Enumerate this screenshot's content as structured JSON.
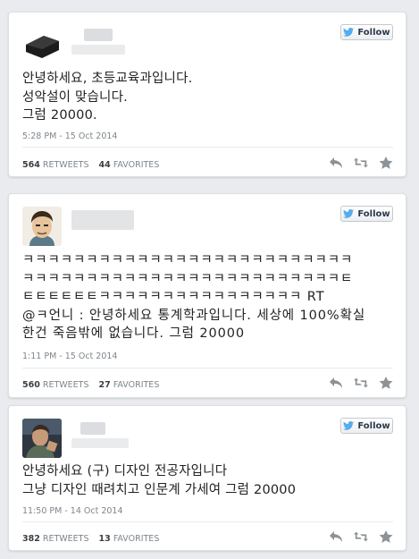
{
  "follow_label": "Follow",
  "tweets": [
    {
      "avatar_icon": "black-box-avatar",
      "text": "안녕하세요, 초등교육과입니다.\n성악설이 맞습니다.\n그럼 20000.",
      "timestamp": "5:28 PM - 15 Oct 2014",
      "retweets": "564",
      "retweets_label": "RETWEETS",
      "favorites": "44",
      "favorites_label": "FAVORITES"
    },
    {
      "avatar_icon": "cartoon-face-avatar",
      "text": "ㅋㅋㅋㅋㅋㅋㅋㅋㅋㅋㅋㅋㅋㅋㅋㅋㅋㅋㅋㅋㅋㅋㅋㅋㅋㅋ\nㅋㅋㅋㅋㅋㅋㅋㅋㅋㅋㅋㅋㅋㅋㅋㅋㅋㅋㅋㅋㅋㅋㅋㅋㅋㅌ\nㅌㅌㅌㅌㅌㅌㅋㅋㅋㅋㅋㅋㅋㅋㅋㅋㅋㅋㅋㅋㅋㅋ RT\n@ㅋ언니 : 안녕하세요 통계학과입니다. 세상에 100%확실\n한건 죽음밖에 없습니다. 그럼 20000",
      "timestamp": "1:11 PM - 15 Oct 2014",
      "retweets": "560",
      "retweets_label": "RETWEETS",
      "favorites": "27",
      "favorites_label": "FAVORITES"
    },
    {
      "avatar_icon": "person-photo-avatar",
      "text": "안녕하세요 (구) 디자인 전공자입니다\n그냥 디자인 때려치고 인문계 가세여 그럼 20000",
      "timestamp": "11:50 PM - 14 Oct 2014",
      "retweets": "382",
      "retweets_label": "RETWEETS",
      "favorites": "13",
      "favorites_label": "FAVORITES"
    }
  ],
  "colors": {
    "background": "#e9ebee",
    "card": "#ffffff",
    "bird_blue": "#55acee",
    "meta_gray": "#7e868c"
  }
}
